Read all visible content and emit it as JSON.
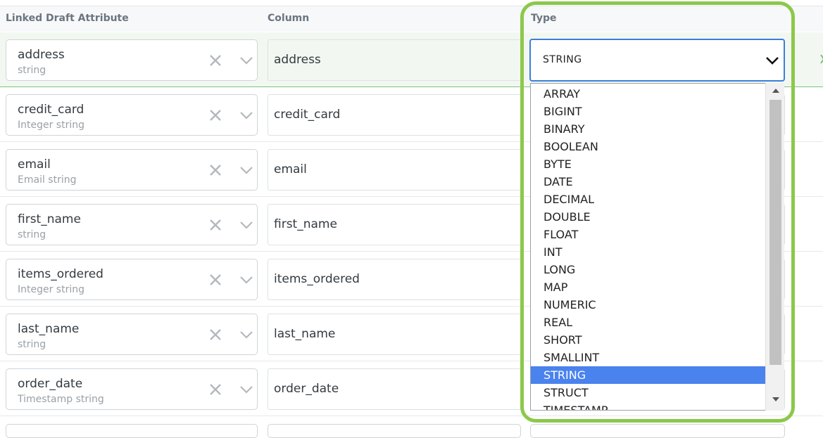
{
  "header": {
    "col_attribute": "Linked Draft Attribute",
    "col_column": "Column",
    "col_type": "Type"
  },
  "rows": [
    {
      "attribute": "address",
      "subtype": "string",
      "column": "address"
    },
    {
      "attribute": "credit_card",
      "subtype": "Integer string",
      "column": "credit_card"
    },
    {
      "attribute": "email",
      "subtype": "Email string",
      "column": "email"
    },
    {
      "attribute": "first_name",
      "subtype": "string",
      "column": "first_name"
    },
    {
      "attribute": "items_ordered",
      "subtype": "Integer string",
      "column": "items_ordered"
    },
    {
      "attribute": "last_name",
      "subtype": "string",
      "column": "last_name"
    },
    {
      "attribute": "order_date",
      "subtype": "Timestamp string",
      "column": "order_date"
    }
  ],
  "type_select": {
    "value": "STRING",
    "options": [
      "ARRAY",
      "BIGINT",
      "BINARY",
      "BOOLEAN",
      "BYTE",
      "DATE",
      "DECIMAL",
      "DOUBLE",
      "FLOAT",
      "INT",
      "LONG",
      "MAP",
      "NUMERIC",
      "REAL",
      "SHORT",
      "SMALLINT",
      "STRING",
      "STRUCT",
      "TIMESTAMP"
    ]
  },
  "icons": {
    "clear": "close-icon",
    "dropdown": "chevron-down-icon",
    "scroll_up": "arrow-up-icon",
    "scroll_down": "arrow-down-icon"
  },
  "colors": {
    "highlight_frame": "#8cc84b",
    "select_border": "#3b7fd9",
    "selected_option": "#4a82ee",
    "selected_row": "#f2f8f1"
  }
}
